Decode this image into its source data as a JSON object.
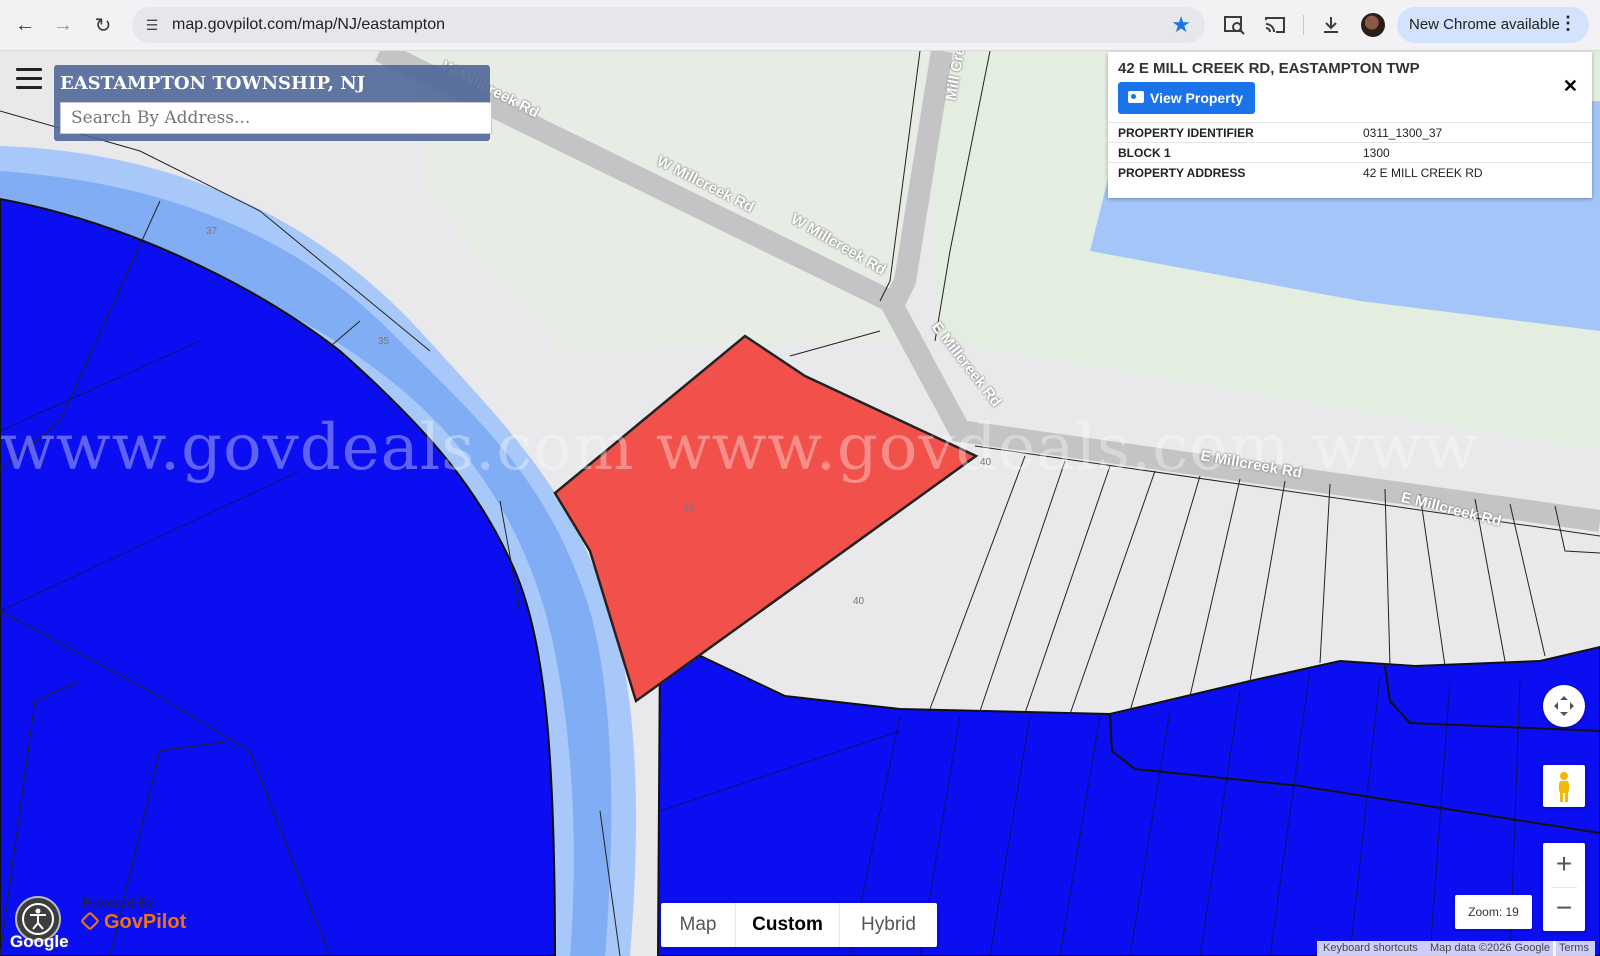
{
  "browser": {
    "url": "map.govpilot.com/map/NJ/eastampton",
    "update_label": "New Chrome available",
    "menu_glyph": "⋮",
    "icons": [
      "back-icon",
      "forward-icon",
      "reload-icon",
      "site-info-icon",
      "bookmark-star-icon",
      "lens-search-icon",
      "cast-icon",
      "download-icon",
      "profile-avatar",
      "more-icon"
    ]
  },
  "search": {
    "title": "EASTAMPTON TOWNSHIP, NJ",
    "placeholder": "Search By Address..."
  },
  "property_card": {
    "heading": "42 E MILL CREEK RD, EASTAMPTON TWP",
    "view_button": "View Property",
    "close": "✕",
    "rows": [
      {
        "key": "PROPERTY IDENTIFIER",
        "value": "0311_1300_37"
      },
      {
        "key": "BLOCK 1",
        "value": "1300"
      },
      {
        "key": "PROPERTY ADDRESS",
        "value": "42 E MILL CREEK RD"
      }
    ]
  },
  "map": {
    "watermark": "www.govdeals.com  www.govdeals.com  www",
    "roads": [
      "W Millcreek Rd",
      "W Millcreek Rd",
      "W Millcreek Rd",
      "Mill Cree",
      "E Millcreek Rd",
      "E Millcreek Rd",
      "E Millcreek Rd"
    ],
    "lot_numbers": [
      "37",
      "35",
      "42",
      "40",
      "40"
    ],
    "selected_parcel_color": "#f2504a",
    "water_color": "#0a0cf0",
    "stream_color": "#8bb8f5"
  },
  "map_type": {
    "options": [
      "Map",
      "Custom",
      "Hybrid"
    ],
    "selected": "Custom"
  },
  "controls": {
    "zoom_text": "Zoom: 19",
    "zoom_in": "+",
    "zoom_out": "−"
  },
  "attribution": {
    "shortcuts": "Keyboard shortcuts",
    "map_data": "Map data ©2026 Google",
    "terms": "Terms"
  },
  "branding": {
    "powered_by": "Powered By",
    "govpilot": "GovPilot",
    "google": "Google"
  }
}
